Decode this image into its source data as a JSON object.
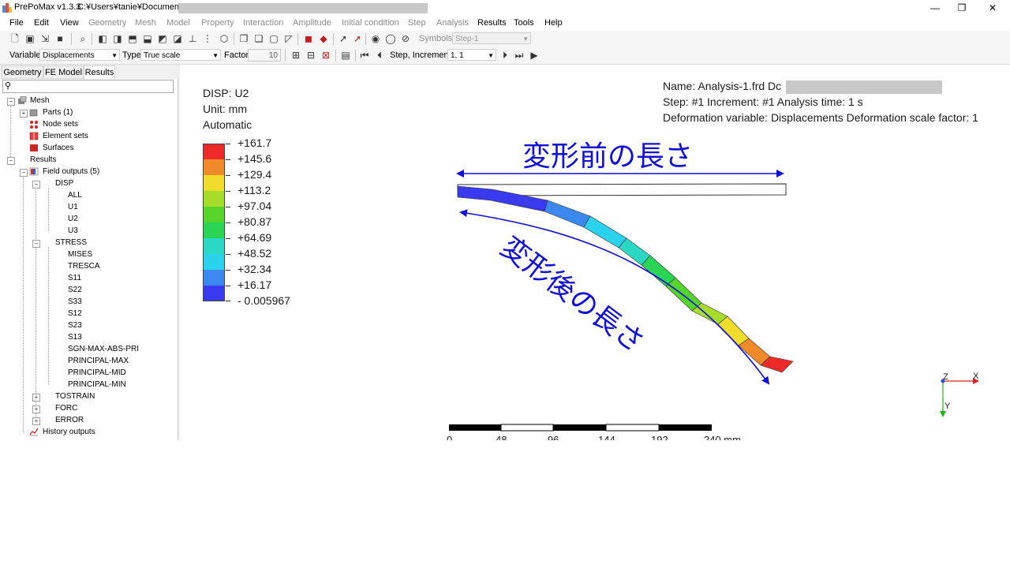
{
  "window": {
    "title": "PrePoMax v1.3.3",
    "path": "C:¥Users¥tanie¥Documents¥",
    "minimize_glyph": "—",
    "maximize_glyph": "❐",
    "close_glyph": "✕"
  },
  "menu": [
    "File",
    "Edit",
    "View",
    "Geometry",
    "Mesh",
    "Model",
    "Property",
    "Interaction",
    "Amplitude",
    "Initial condition",
    "Step",
    "Analysis",
    "Results",
    "Tools",
    "Help"
  ],
  "toolbar1": {
    "symbols_label": "Symbols",
    "step_value": "Step-1"
  },
  "toolbar2": {
    "variable_label": "Variable",
    "variable_value": "Displacements",
    "type_label": "Type",
    "type_value": "True scale",
    "factor_label": "Factor",
    "factor_value": "10",
    "step_increment_label": "Step, Increment",
    "step_increment_value": "1, 1"
  },
  "tabs": [
    "Geometry",
    "FE Model",
    "Results"
  ],
  "active_tab": "Results",
  "tree": {
    "mesh": "Mesh",
    "parts": "Parts (1)",
    "node_sets": "Node sets",
    "element_sets": "Element sets",
    "surfaces": "Surfaces",
    "results": "Results",
    "field_outputs": "Field outputs (5)",
    "disp": "DISP",
    "disp_items": [
      "ALL",
      "U1",
      "U2",
      "U3"
    ],
    "stress": "STRESS",
    "stress_items": [
      "MISES",
      "TRESCA",
      "S11",
      "S22",
      "S33",
      "S12",
      "S23",
      "S13",
      "SGN-MAX-ABS-PRI",
      "PRINCIPAL-MAX",
      "PRINCIPAL-MID",
      "PRINCIPAL-MIN"
    ],
    "tostrain": "TOSTRAIN",
    "forc": "FORC",
    "error": "ERROR",
    "history_outputs": "History outputs"
  },
  "legend": {
    "title": "DISP: U2",
    "unit": "Unit: mm",
    "mode": "Automatic",
    "colors": [
      "#ee2a2a",
      "#f38a2a",
      "#f0dc2a",
      "#a6dc2a",
      "#55d42a",
      "#2ad455",
      "#2ad8c4",
      "#2ad2ee",
      "#3a88f0",
      "#3a3af0"
    ],
    "values": [
      "+161.7",
      "+145.6",
      "+129.4",
      "+113.2",
      "+97.04",
      "+80.87",
      "+64.69",
      "+48.52",
      "+32.34",
      "+16.17",
      "- 0.005967"
    ]
  },
  "info": {
    "name_prefix": "Name: Analysis-1.frd   Dc",
    "step_line": "Step: #1   Increment: #1   Analysis time: 1 s",
    "deformation_line": "Deformation variable: Displacements   Deformation scale factor: 1"
  },
  "annotations": {
    "before_length": "変形前の長さ",
    "after_length": "変形後の長さ",
    "arrow_color": "#1010d8"
  },
  "scale_bar": {
    "labels": [
      "0",
      "48",
      "96",
      "144",
      "192",
      "240 mm"
    ]
  },
  "axes": {
    "z": "Z",
    "x": "X",
    "y": "Y"
  }
}
